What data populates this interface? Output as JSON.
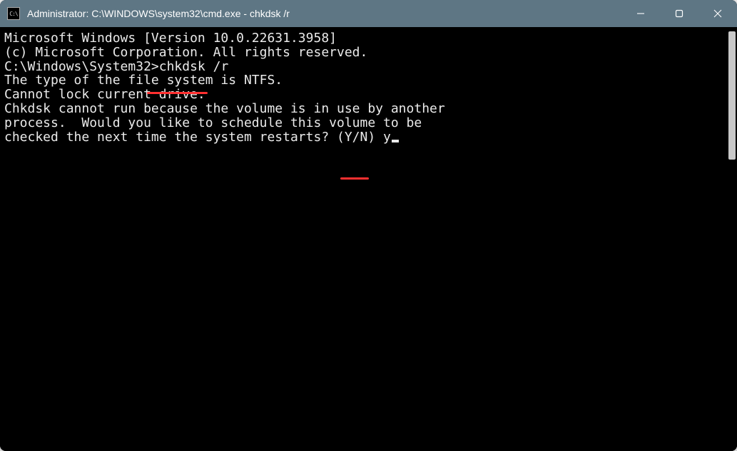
{
  "window": {
    "title": "Administrator: C:\\WINDOWS\\system32\\cmd.exe - chkdsk  /r"
  },
  "console": {
    "banner_line1": "Microsoft Windows [Version 10.0.22631.3958]",
    "banner_line2": "(c) Microsoft Corporation. All rights reserved.",
    "blank1": "",
    "prompt_prefix": "C:\\Windows\\System32>",
    "command": "chkdsk /r",
    "out1": "The type of the file system is NTFS.",
    "out2": "Cannot lock current drive.",
    "blank2": "",
    "msg1": "Chkdsk cannot run because the volume is in use by another",
    "msg2": "process.  Would you like to schedule this volume to be",
    "msg3_prefix": "checked the next time the system restarts? (Y/N) ",
    "answer": "y"
  },
  "annotations": {
    "underline_command": true,
    "underline_answer": true
  }
}
